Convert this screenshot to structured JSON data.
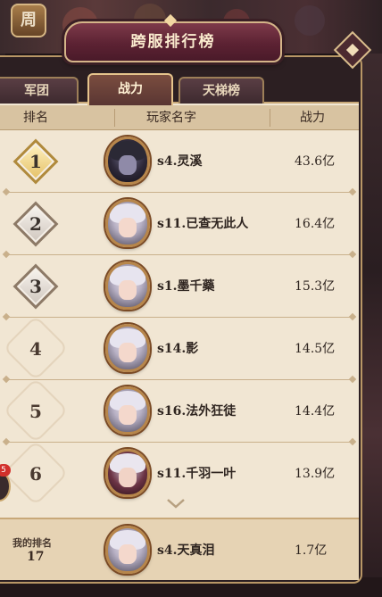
{
  "window": {
    "title": "跨服排行榜",
    "shop_icon_glyph": "周"
  },
  "tabs": [
    {
      "label": "军团",
      "active": false
    },
    {
      "label": "战力",
      "active": true
    },
    {
      "label": "天梯榜",
      "active": false
    }
  ],
  "columns": {
    "rank": "排名",
    "player_name": "玩家名字",
    "power": "战力"
  },
  "rows": [
    {
      "rank": "1",
      "name": "s4.灵溪",
      "power": "43.6亿",
      "avatar": "dark-armor-portrait"
    },
    {
      "rank": "2",
      "name": "s11.已查无此人",
      "power": "16.4亿",
      "avatar": "white-hair-portrait"
    },
    {
      "rank": "3",
      "name": "s1.墨千藥",
      "power": "15.3亿",
      "avatar": "winged-helm-portrait"
    },
    {
      "rank": "4",
      "name": "s14.影",
      "power": "14.5亿",
      "avatar": "white-hair-portrait"
    },
    {
      "rank": "5",
      "name": "s16.法外狂徒",
      "power": "14.4亿",
      "avatar": "white-hair-portrait"
    },
    {
      "rank": "6",
      "name": "s11.千羽一叶",
      "power": "13.9亿",
      "avatar": "crimson-armor-portrait"
    }
  ],
  "my_rank": {
    "label": "我的排名",
    "rank": "17",
    "name": "s4.天真泪",
    "power": "1.7亿",
    "avatar": "white-hair-portrait"
  },
  "side_notification_count": "5",
  "colors": {
    "panel_bg": "#f1e6d3",
    "title_banner": "#5c2233",
    "gold_trim": "#d5b589",
    "notification_red": "#d2302b"
  }
}
